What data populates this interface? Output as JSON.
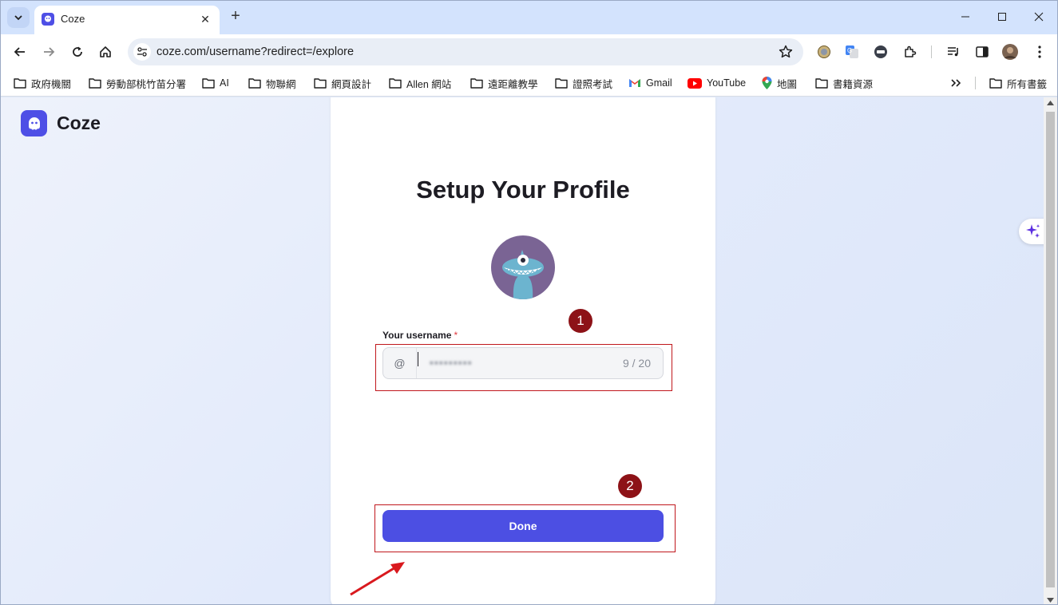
{
  "browser": {
    "tab_title": "Coze",
    "url": "coze.com/username?redirect=/explore",
    "bookmarks": [
      {
        "label": "政府機關",
        "type": "folder"
      },
      {
        "label": "勞動部桃竹苗分署",
        "type": "folder"
      },
      {
        "label": "AI",
        "type": "folder"
      },
      {
        "label": "物聯網",
        "type": "folder"
      },
      {
        "label": "網頁設計",
        "type": "folder"
      },
      {
        "label": "Allen 網站",
        "type": "folder"
      },
      {
        "label": "遠距離教學",
        "type": "folder"
      },
      {
        "label": "證照考試",
        "type": "folder"
      },
      {
        "label": "Gmail",
        "type": "gmail"
      },
      {
        "label": "YouTube",
        "type": "youtube"
      },
      {
        "label": "地圖",
        "type": "maps"
      },
      {
        "label": "書籍資源",
        "type": "folder"
      }
    ],
    "all_bookmarks_label": "所有書籤"
  },
  "page": {
    "brand": "Coze",
    "title": "Setup Your Profile",
    "username_field": {
      "label": "Your username",
      "required_mark": "*",
      "prefix": "@",
      "value": "▪▪▪▪▪▪▪▪▪",
      "counter": "9 / 20"
    },
    "submit_label": "Done"
  },
  "annotations": {
    "badge_1": "1",
    "badge_2": "2"
  },
  "colors": {
    "brand": "#4e4fe6",
    "button": "#4c4fe3",
    "annotation_red": "#c0171c"
  }
}
